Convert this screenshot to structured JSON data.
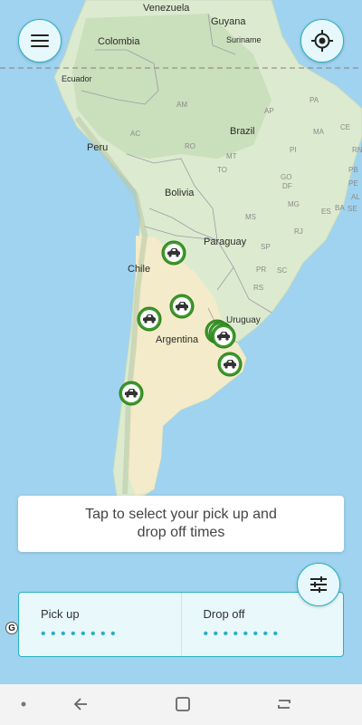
{
  "map": {
    "country_labels": [
      {
        "id": "venezuela",
        "text": "Venezuela"
      },
      {
        "id": "guyana",
        "text": "Guyana"
      },
      {
        "id": "colombia",
        "text": "Colombia"
      },
      {
        "id": "suriname",
        "text": "Suriname"
      },
      {
        "id": "ecuador",
        "text": "Ecuador"
      },
      {
        "id": "peru",
        "text": "Peru"
      },
      {
        "id": "brazil",
        "text": "Brazil"
      },
      {
        "id": "bolivia",
        "text": "Bolivia"
      },
      {
        "id": "paraguay",
        "text": "Paraguay"
      },
      {
        "id": "chile",
        "text": "Chile"
      },
      {
        "id": "argentina",
        "text": "Argentina"
      },
      {
        "id": "uruguay",
        "text": "Uruguay"
      }
    ],
    "state_labels": [
      "AP",
      "AM",
      "PA",
      "MA",
      "CE",
      "PI",
      "RN",
      "PB",
      "PE",
      "AL",
      "SE",
      "BA",
      "AC",
      "RO",
      "MT",
      "TO",
      "GO",
      "DF",
      "MG",
      "ES",
      "MS",
      "SP",
      "RJ",
      "PR",
      "SC",
      "RS"
    ],
    "car_markers_count": 8
  },
  "header": {
    "menu_icon": "hamburger-menu-icon",
    "locate_icon": "crosshair-location-icon"
  },
  "hint": {
    "text": "Tap to select your pick up and\ndrop off times"
  },
  "times": {
    "pickup_label": "Pick up",
    "pickup_value": "••••••••",
    "dropoff_label": "Drop off",
    "dropoff_value": "••••••••",
    "filter_icon": "sliders-filter-icon"
  },
  "attribution": {
    "logo_letter": "G"
  },
  "colors": {
    "accent": "#2ab0c4",
    "accent_bg": "#e6f8fb",
    "marker_green": "#3d9a2a",
    "water": "#9fd3ef",
    "land": "#dcebcf",
    "desert": "#f3ebc9"
  },
  "nav": {
    "items": [
      "dot-icon",
      "back-icon",
      "home-icon",
      "recents-icon"
    ]
  }
}
